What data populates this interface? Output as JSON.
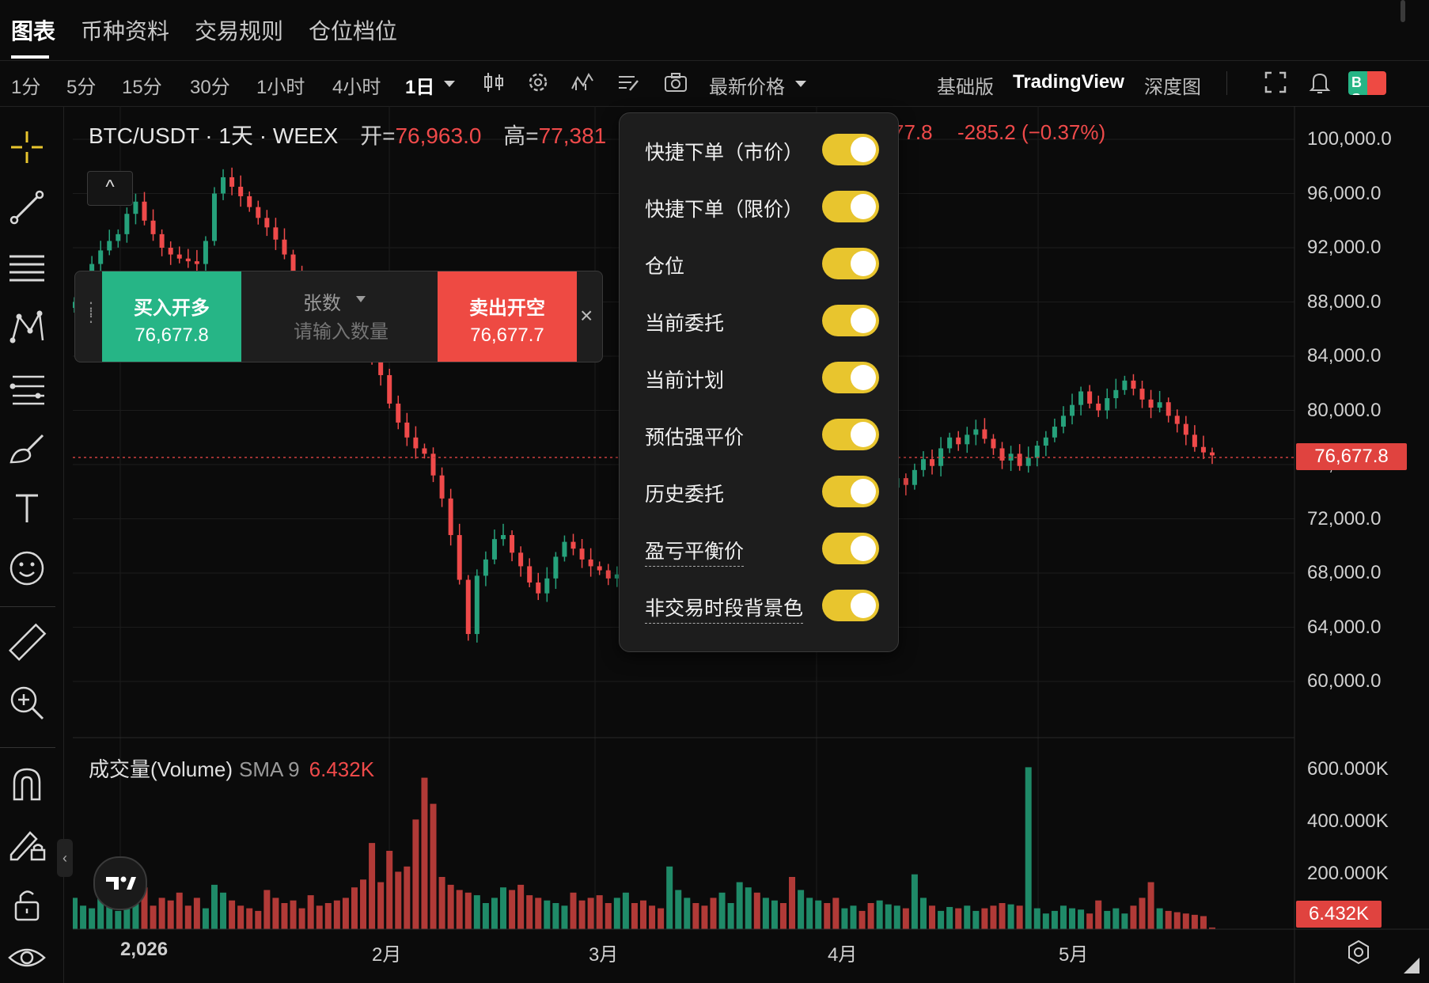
{
  "top_tabs": [
    "图表",
    "币种资料",
    "交易规则",
    "仓位档位"
  ],
  "toolbar": {
    "intervals": [
      "1分",
      "5分",
      "15分",
      "30分",
      "1小时",
      "4小时",
      "1日"
    ],
    "active_interval": "1日",
    "price_type": "最新价格",
    "views": [
      "基础版",
      "TradingView",
      "深度图"
    ],
    "active_view": "TradingView",
    "icons": [
      "candlestick-icon",
      "gear-icon",
      "indicator-icon",
      "template-icon",
      "camera-icon",
      "fullscreen-icon",
      "bell-icon",
      "bs-icon"
    ],
    "bs_badge": "B S"
  },
  "left_tools": [
    "crosshair-icon",
    "trend-line-icon",
    "horizontal-lines-icon",
    "pattern-icon",
    "fib-icon",
    "brush-icon",
    "text-icon",
    "emoji-icon",
    "ruler-icon",
    "zoom-in-icon",
    "magnet-icon",
    "lock-draw-icon",
    "unlock-icon",
    "eye-icon"
  ],
  "legend": {
    "symbol": "BTC/USDT · 1天 · WEEX",
    "open_label": "开=",
    "open": "76,963.0",
    "high_label": "高=",
    "high": "77,381",
    "close_fragment": "77.8",
    "change": "-285.2 (−0.37%)",
    "collapse": "^"
  },
  "price_axis": [
    "100,000.0",
    "96,000.0",
    "92,000.0",
    "88,000.0",
    "84,000.0",
    "80,000.0",
    "76,000.0",
    "72,000.0",
    "68,000.0",
    "64,000.0",
    "60,000.0"
  ],
  "last_price": "76,677.8",
  "volume_legend": {
    "name": "成交量(Volume)",
    "sma": "SMA 9",
    "value": "6.432K"
  },
  "volume_axis": [
    "600.000K",
    "400.000K",
    "200.000K"
  ],
  "last_volume": "6.432K",
  "date_axis": [
    "2,026",
    "2月",
    "3月",
    "4月",
    "5月"
  ],
  "quick_order": {
    "buy_label": "买入开多",
    "buy_price": "76,677.8",
    "unit": "张数",
    "qty_placeholder": "请输入数量",
    "sell_label": "卖出开空",
    "sell_price": "76,677.7",
    "close": "×"
  },
  "settings_menu": [
    {
      "label": "快捷下单（市价）",
      "on": true
    },
    {
      "label": "快捷下单（限价）",
      "on": true
    },
    {
      "label": "仓位",
      "on": true
    },
    {
      "label": "当前委托",
      "on": true
    },
    {
      "label": "当前计划",
      "on": true
    },
    {
      "label": "预估强平价",
      "on": true
    },
    {
      "label": "历史委托",
      "on": true
    },
    {
      "label": "盈亏平衡价",
      "on": true,
      "dashed": true
    },
    {
      "label": "非交易时段背景色",
      "on": true,
      "dashed": true
    }
  ],
  "colors": {
    "up": "#26a17b",
    "down": "#ef4a4a",
    "toggle": "#e8c52e",
    "buy": "#26b586",
    "sell": "#ee4a43"
  },
  "chart_data": {
    "type": "candlestick",
    "symbol": "BTC/USDT",
    "interval": "1天",
    "ylim": [
      58000,
      101000
    ],
    "price_series_approx": [
      88000,
      89500,
      90800,
      91800,
      92500,
      93000,
      94500,
      95400,
      94000,
      93000,
      92000,
      91500,
      91200,
      91000,
      90800,
      92500,
      96000,
      97200,
      96500,
      95800,
      95000,
      94200,
      93500,
      92600,
      91500,
      90200,
      89400,
      88700,
      88100,
      87600,
      87200,
      86500,
      85800,
      85000,
      84000,
      82600,
      80500,
      79100,
      78000,
      77200,
      76800,
      75200,
      73500,
      70800,
      67500,
      63500,
      67800,
      69000,
      70500,
      70800,
      69500,
      68500,
      67300,
      66500,
      67600,
      69200,
      70300,
      69800,
      69000,
      68500,
      68200,
      67600,
      67900,
      68400,
      67800,
      67000,
      65800,
      64600,
      66200,
      68200,
      69600,
      69000,
      68300,
      67200,
      68000,
      69200,
      70500,
      71200,
      70600,
      71400,
      72000,
      71500,
      70800,
      71600,
      72400,
      73200,
      71800,
      70200,
      71600,
      72600,
      71900,
      71500,
      72800,
      74300,
      75000,
      74500,
      75600,
      76400,
      75900,
      77200,
      78000,
      77500,
      78200,
      78600,
      77900,
      77200,
      76300,
      76800,
      75900,
      76500,
      77400,
      78000,
      78800,
      79600,
      80400,
      81400,
      80500,
      80000,
      80900,
      81500,
      82200,
      81600,
      80800,
      80200,
      80600,
      79600,
      79000,
      78200,
      77300,
      76900,
      76678
    ],
    "volume_series_approx_k": [
      120,
      90,
      80,
      150,
      110,
      70,
      130,
      100,
      160,
      90,
      120,
      110,
      140,
      90,
      120,
      80,
      170,
      140,
      110,
      90,
      80,
      70,
      150,
      120,
      100,
      110,
      80,
      130,
      90,
      100,
      110,
      120,
      160,
      190,
      330,
      180,
      300,
      220,
      240,
      420,
      580,
      480,
      200,
      170,
      150,
      140,
      130,
      100,
      120,
      160,
      150,
      170,
      130,
      120,
      110,
      100,
      90,
      140,
      110,
      120,
      130,
      100,
      120,
      140,
      100,
      110,
      90,
      80,
      240,
      150,
      120,
      100,
      90,
      120,
      140,
      100,
      180,
      160,
      140,
      120,
      110,
      100,
      200,
      150,
      120,
      110,
      100,
      120,
      80,
      90,
      70,
      100,
      110,
      95,
      90,
      80,
      210,
      120,
      90,
      70,
      85,
      80,
      90,
      70,
      80,
      90,
      100,
      95,
      90,
      620,
      80,
      60,
      70,
      90,
      80,
      75,
      60,
      110,
      70,
      80,
      60,
      90,
      120,
      180,
      80,
      70,
      65,
      60,
      55,
      50,
      6.432
    ],
    "price_axis_labels": [
      "100,000.0",
      "96,000.0",
      "92,000.0",
      "88,000.0",
      "84,000.0",
      "80,000.0",
      "76,000.0",
      "72,000.0",
      "68,000.0",
      "64,000.0",
      "60,000.0"
    ],
    "volume_axis_labels": [
      "600.000K",
      "400.000K",
      "200.000K"
    ],
    "x_labels": [
      "2,026",
      "2月",
      "3月",
      "4月",
      "5月"
    ],
    "last_price": 76677.8,
    "last_volume": "6.432K"
  }
}
